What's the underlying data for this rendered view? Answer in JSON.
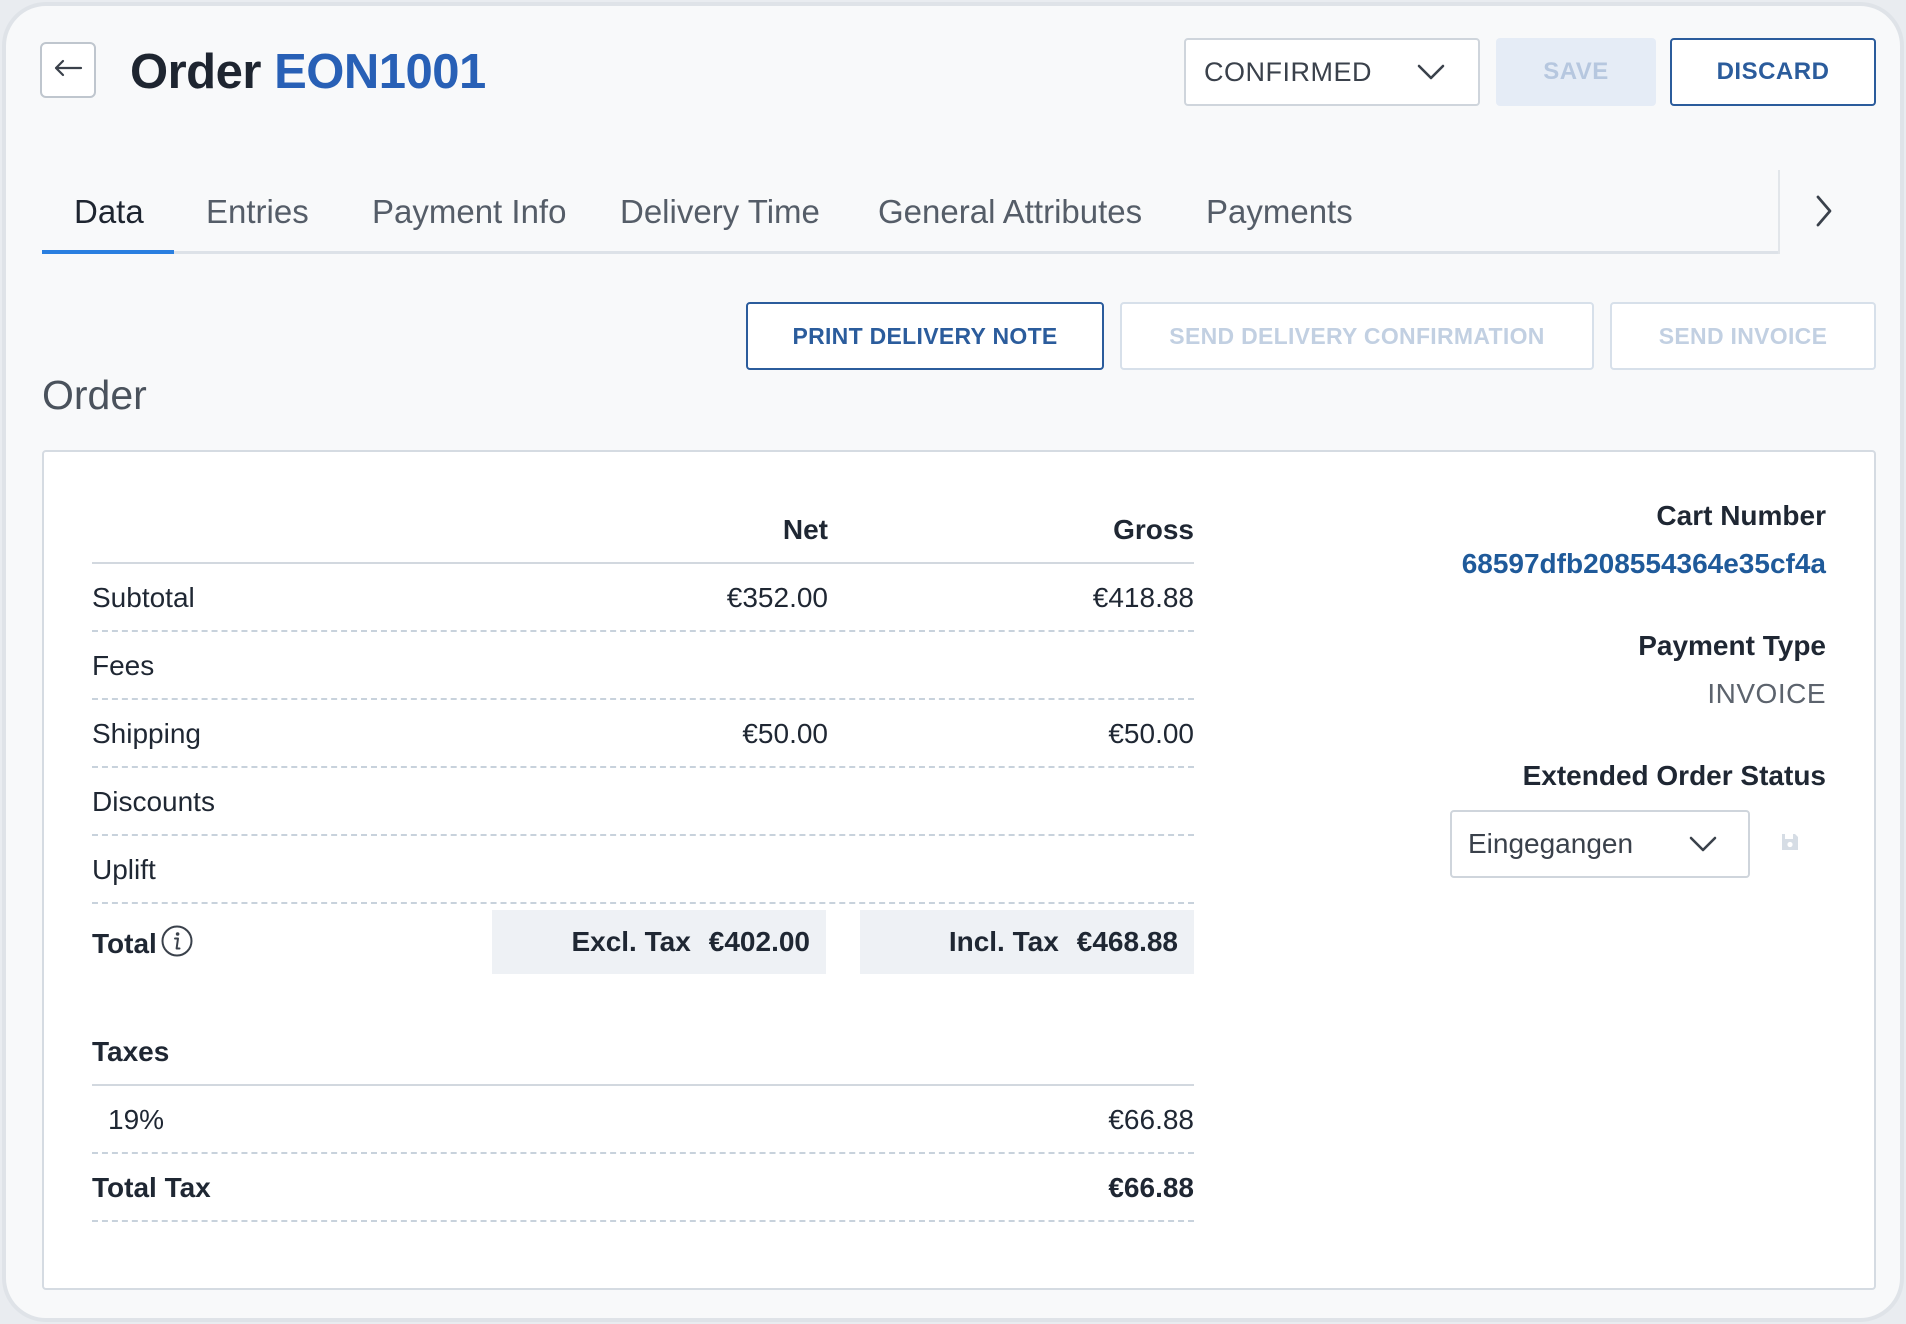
{
  "header": {
    "title_prefix": "Order",
    "order_id": "EON1001",
    "status_value": "CONFIRMED",
    "save_label": "SAVE",
    "discard_label": "DISCARD"
  },
  "tabs": [
    {
      "label": "Data",
      "active": true
    },
    {
      "label": "Entries"
    },
    {
      "label": "Payment Info"
    },
    {
      "label": "Delivery Time"
    },
    {
      "label": "General Attributes"
    },
    {
      "label": "Payments"
    }
  ],
  "actions": {
    "print_delivery_note": "PRINT DELIVERY NOTE",
    "send_delivery_confirmation": "SEND DELIVERY CONFIRMATION",
    "send_invoice": "SEND INVOICE"
  },
  "section_title": "Order",
  "totals": {
    "net_header": "Net",
    "gross_header": "Gross",
    "rows": [
      {
        "label": "Subtotal",
        "net": "€352.00",
        "gross": "€418.88"
      },
      {
        "label": "Fees",
        "net": "",
        "gross": ""
      },
      {
        "label": "Shipping",
        "net": "€50.00",
        "gross": "€50.00"
      },
      {
        "label": "Discounts",
        "net": "",
        "gross": ""
      },
      {
        "label": "Uplift",
        "net": "",
        "gross": ""
      }
    ],
    "total_label": "Total",
    "excl_tax_label": "Excl. Tax",
    "excl_tax_value": "€402.00",
    "incl_tax_label": "Incl. Tax",
    "incl_tax_value": "€468.88"
  },
  "taxes": {
    "title": "Taxes",
    "rows": [
      {
        "rate": "19%",
        "amount": "€66.88"
      }
    ],
    "total_label": "Total Tax",
    "total_value": "€66.88"
  },
  "details": {
    "cart_number_label": "Cart Number",
    "cart_number": "68597dfb208554364e35cf4a",
    "payment_type_label": "Payment Type",
    "payment_type": "INVOICE",
    "extended_status_label": "Extended Order Status",
    "extended_status_value": "Eingegangen"
  },
  "icons": {
    "back": "arrow-left-icon",
    "chevron_down": "chevron-down-icon",
    "chevron_right": "chevron-right-icon",
    "info": "info-icon",
    "save": "floppy-disk-icon"
  },
  "colors": {
    "accent_blue": "#2860b6",
    "link_blue": "#1f5a9a",
    "tab_underline": "#2a7fe0",
    "button_border": "#2b5c9c"
  }
}
